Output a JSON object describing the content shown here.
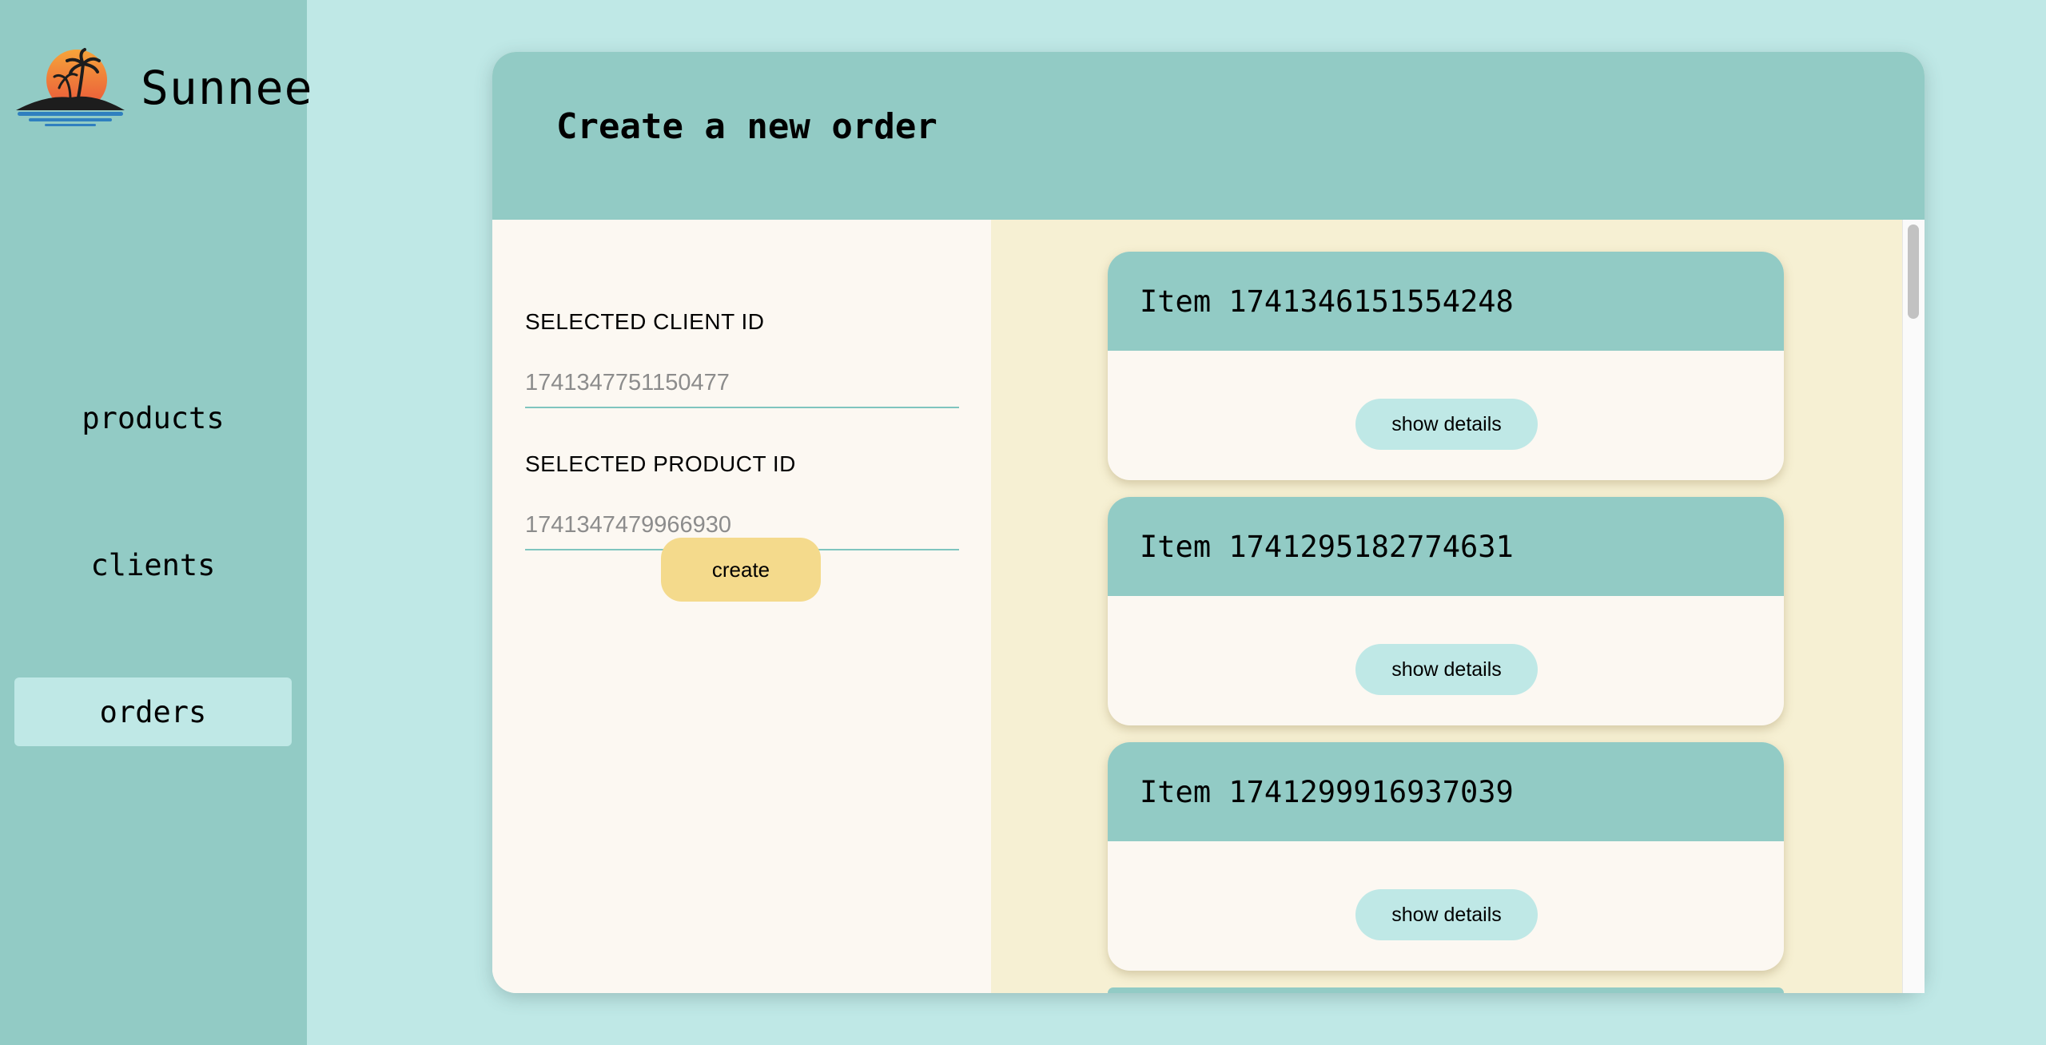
{
  "brand": {
    "name": "Sunnee",
    "logo_icon": "sunset-island-palm-logo",
    "colors": {
      "sun_top": "#f6a43a",
      "sun_bottom": "#e9553a",
      "island": "#1d1d1d",
      "water": "#2f7fbf"
    }
  },
  "sidebar": {
    "items": [
      {
        "label": "products",
        "active": false
      },
      {
        "label": "clients",
        "active": false
      },
      {
        "label": "orders",
        "active": true
      }
    ]
  },
  "page": {
    "title": "Create a new order"
  },
  "form": {
    "client_label": "SELECTED CLIENT ID",
    "client_placeholder": "1741347751150477",
    "product_label": "SELECTED PRODUCT ID",
    "product_placeholder": "1741347479966930",
    "create_label": "create"
  },
  "items": [
    {
      "title": "Item 1741346151554248",
      "button": "show details"
    },
    {
      "title": "Item 1741295182774631",
      "button": "show details"
    },
    {
      "title": "Item 1741299916937039",
      "button": "show details"
    }
  ],
  "colors": {
    "page_bg": "#bfe8e6",
    "sidebar_bg": "#92cbc5",
    "header_bg": "#92cbc5",
    "form_bg": "#fcf8f2",
    "list_bg": "#f6f0d3",
    "create_button": "#f4da8c",
    "details_button": "#bfe8e6"
  }
}
